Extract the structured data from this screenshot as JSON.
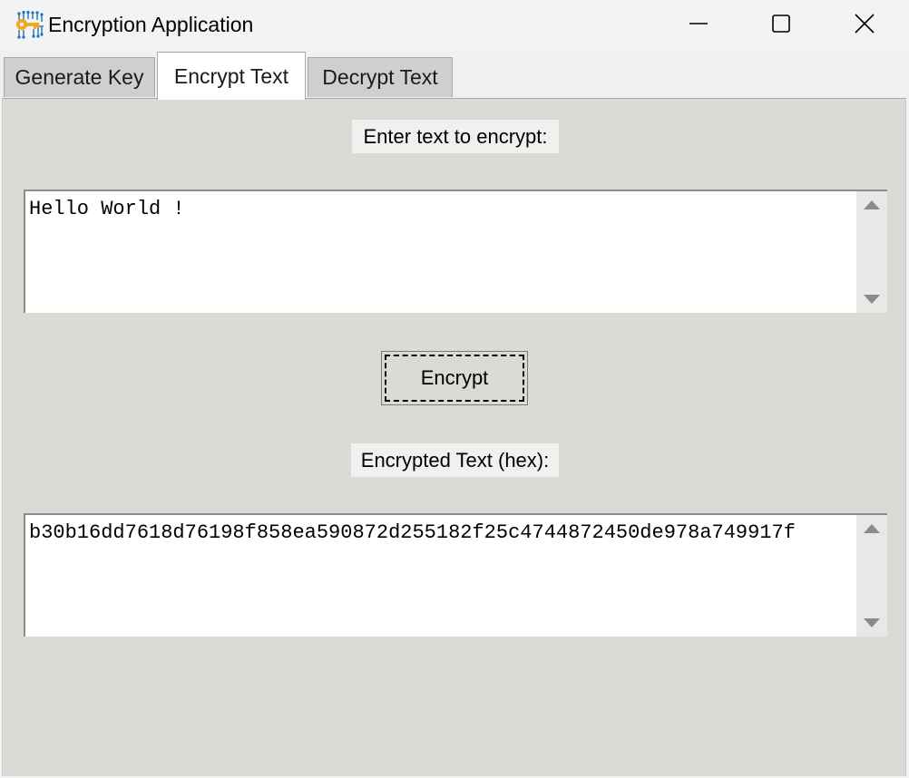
{
  "window": {
    "title": "Encryption Application",
    "app_icon": "key-circuit-icon",
    "controls": [
      "minimize-icon",
      "maximize-icon",
      "close-icon"
    ]
  },
  "tabs": [
    {
      "label": "Generate Key",
      "selected": false
    },
    {
      "label": "Encrypt Text",
      "selected": true
    },
    {
      "label": "Decrypt Text",
      "selected": false
    }
  ],
  "encrypt": {
    "input_label": "Enter text to encrypt:",
    "input_value": "Hello World !",
    "button_label": "Encrypt",
    "output_label": "Encrypted Text (hex):",
    "output_value": "b30b16dd7618d76198f858ea590872d255182f25c4744872450de978a749917f"
  },
  "colors": {
    "panel_bg": "#dcdad5",
    "titlebar_bg": "#f3f3f3",
    "selected_tab_bg": "#ffffff",
    "tab_bg": "#cfcfcf",
    "icon_orange": "#f5a623",
    "icon_blue": "#1e73be"
  }
}
